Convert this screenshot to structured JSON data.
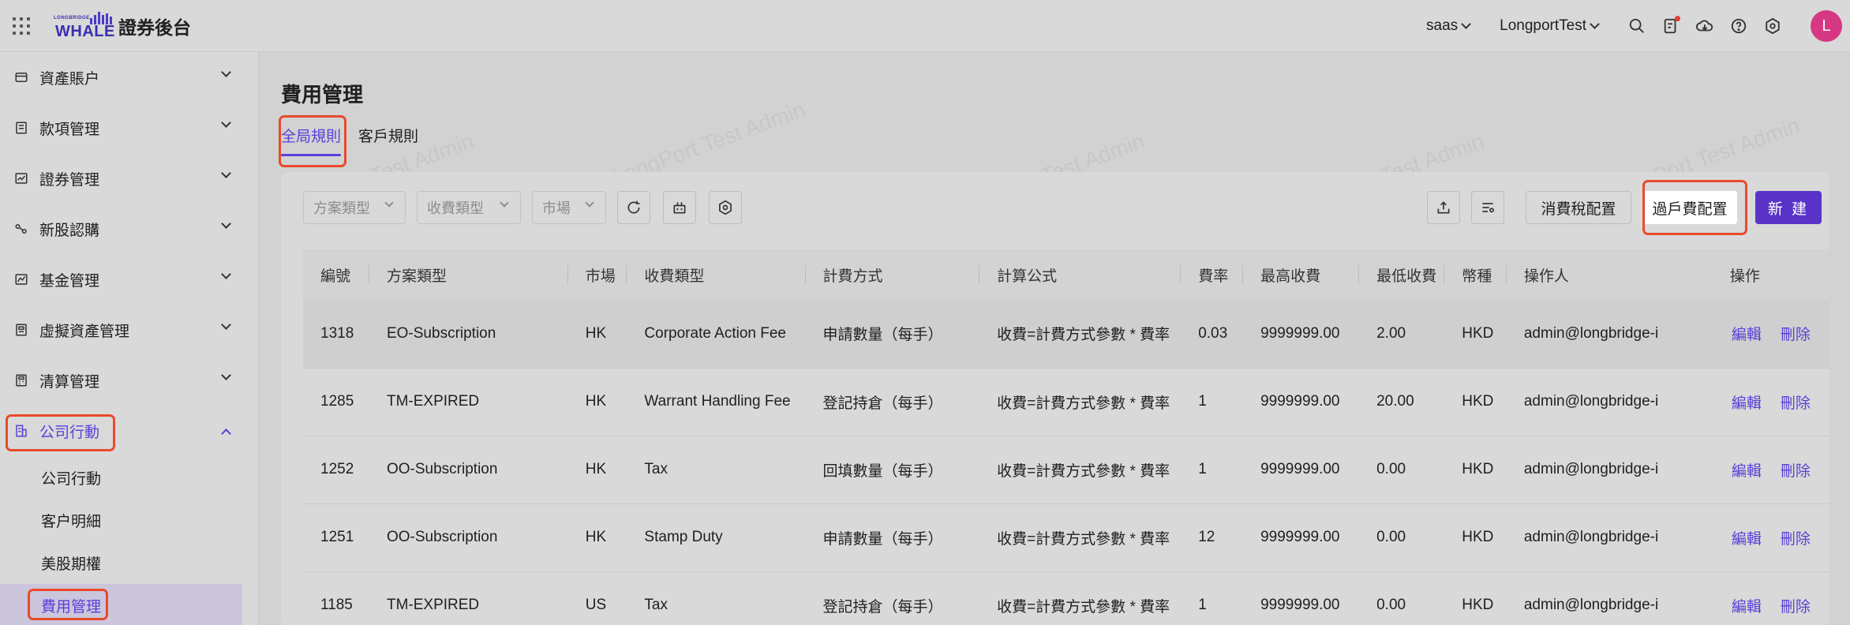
{
  "header": {
    "logo_small": "LONGBRIDGE",
    "logo_word": "WHALE",
    "app_title": "證券後台",
    "org_select": "saas",
    "account_select": "LongportTest",
    "avatar_letter": "L"
  },
  "sidebar": {
    "items": [
      {
        "label": "資產賬户",
        "icon": "wallet-icon"
      },
      {
        "label": "款項管理",
        "icon": "ledger-icon"
      },
      {
        "label": "證券管理",
        "icon": "chart-icon"
      },
      {
        "label": "新股認購",
        "icon": "ipo-icon"
      },
      {
        "label": "基金管理",
        "icon": "fund-icon"
      },
      {
        "label": "虛擬資產管理",
        "icon": "crypto-icon"
      },
      {
        "label": "清算管理",
        "icon": "calculator-icon"
      },
      {
        "label": "公司行動",
        "icon": "building-icon"
      }
    ],
    "sub_items": [
      "公司行動",
      "客户明細",
      "美股期權",
      "費用管理"
    ]
  },
  "main": {
    "title": "費用管理",
    "tabs": [
      "全局規則",
      "客戶規則"
    ],
    "filters": {
      "plan_type": "方案類型",
      "fee_type": "收費類型",
      "market": "市場"
    },
    "buttons": {
      "consumption_tax": "消費稅配置",
      "transfer_fee": "過戶費配置",
      "create": "新 建"
    }
  },
  "table": {
    "columns": [
      "編號",
      "方案類型",
      "市場",
      "收費類型",
      "計費方式",
      "計算公式",
      "費率",
      "最高收費",
      "最低收費",
      "幣種",
      "操作人",
      "操作"
    ],
    "rows": [
      {
        "id": "1318",
        "plan": "EO-Subscription",
        "market": "HK",
        "fee_type": "Corporate Action Fee",
        "method": "申請數量（每手）",
        "formula": "收費=計費方式參數 * 費率",
        "rate": "0.03",
        "max": "9999999.00",
        "min": "2.00",
        "currency": "HKD",
        "operator": "admin@longbridge-i",
        "edit": "編輯",
        "delete": "刪除"
      },
      {
        "id": "1285",
        "plan": "TM-EXPIRED",
        "market": "HK",
        "fee_type": "Warrant Handling Fee",
        "method": "登記持倉（每手）",
        "formula": "收費=計費方式參數 * 費率",
        "rate": "1",
        "max": "9999999.00",
        "min": "20.00",
        "currency": "HKD",
        "operator": "admin@longbridge-i",
        "edit": "編輯",
        "delete": "刪除"
      },
      {
        "id": "1252",
        "plan": "OO-Subscription",
        "market": "HK",
        "fee_type": "Tax",
        "method": "回填數量（每手）",
        "formula": "收費=計費方式參數 * 費率",
        "rate": "1",
        "max": "9999999.00",
        "min": "0.00",
        "currency": "HKD",
        "operator": "admin@longbridge-i",
        "edit": "編輯",
        "delete": "刪除"
      },
      {
        "id": "1251",
        "plan": "OO-Subscription",
        "market": "HK",
        "fee_type": "Stamp Duty",
        "method": "申請數量（每手）",
        "formula": "收費=計費方式參數 * 費率",
        "rate": "12",
        "max": "9999999.00",
        "min": "0.00",
        "currency": "HKD",
        "operator": "admin@longbridge-i",
        "edit": "編輯",
        "delete": "刪除"
      },
      {
        "id": "1185",
        "plan": "TM-EXPIRED",
        "market": "US",
        "fee_type": "Tax",
        "method": "登記持倉（每手）",
        "formula": "收費=計費方式參數 * 費率",
        "rate": "1",
        "max": "9999999.00",
        "min": "0.00",
        "currency": "HKD",
        "operator": "admin@longbridge-i",
        "edit": "編輯",
        "delete": "刪除"
      }
    ]
  },
  "watermark": "LongPort Test Admin",
  "colors": {
    "accent": "#5b3fd8",
    "highlight": "#e94a2c",
    "avatar": "#d63884"
  }
}
